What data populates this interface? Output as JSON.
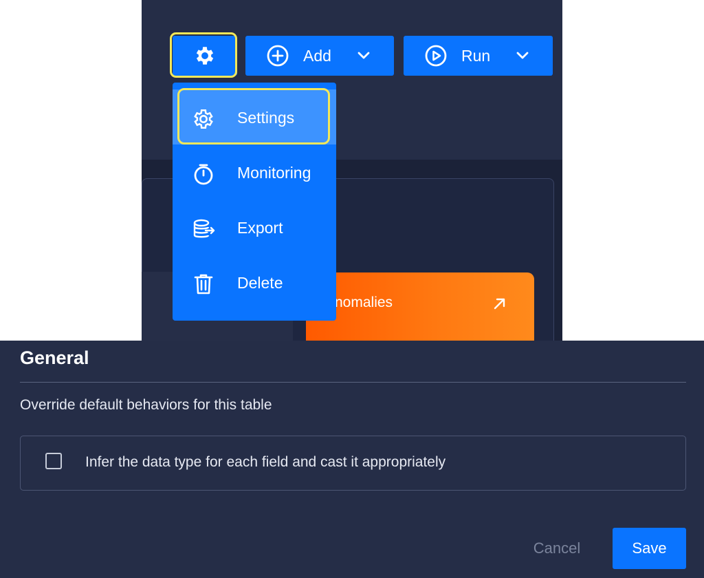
{
  "toolbar": {
    "settings_icon": "gear-icon",
    "add_label": "Add",
    "run_label": "Run"
  },
  "menu": {
    "items": [
      {
        "label": "Settings",
        "icon": "gear-icon"
      },
      {
        "label": "Monitoring",
        "icon": "stopwatch-icon"
      },
      {
        "label": "Export",
        "icon": "database-export-icon"
      },
      {
        "label": "Delete",
        "icon": "trash-icon"
      }
    ]
  },
  "card": {
    "label": "nomalies"
  },
  "modal": {
    "title": "General",
    "description": "Override default behaviors for this table",
    "option_label": "Infer the data type for each field and cast it appropriately",
    "option_checked": false,
    "cancel_label": "Cancel",
    "save_label": "Save"
  },
  "colors": {
    "primary": "#0a74ff",
    "highlight": "#f2e85a",
    "orange": "#ff6a00",
    "background": "#252d47"
  }
}
